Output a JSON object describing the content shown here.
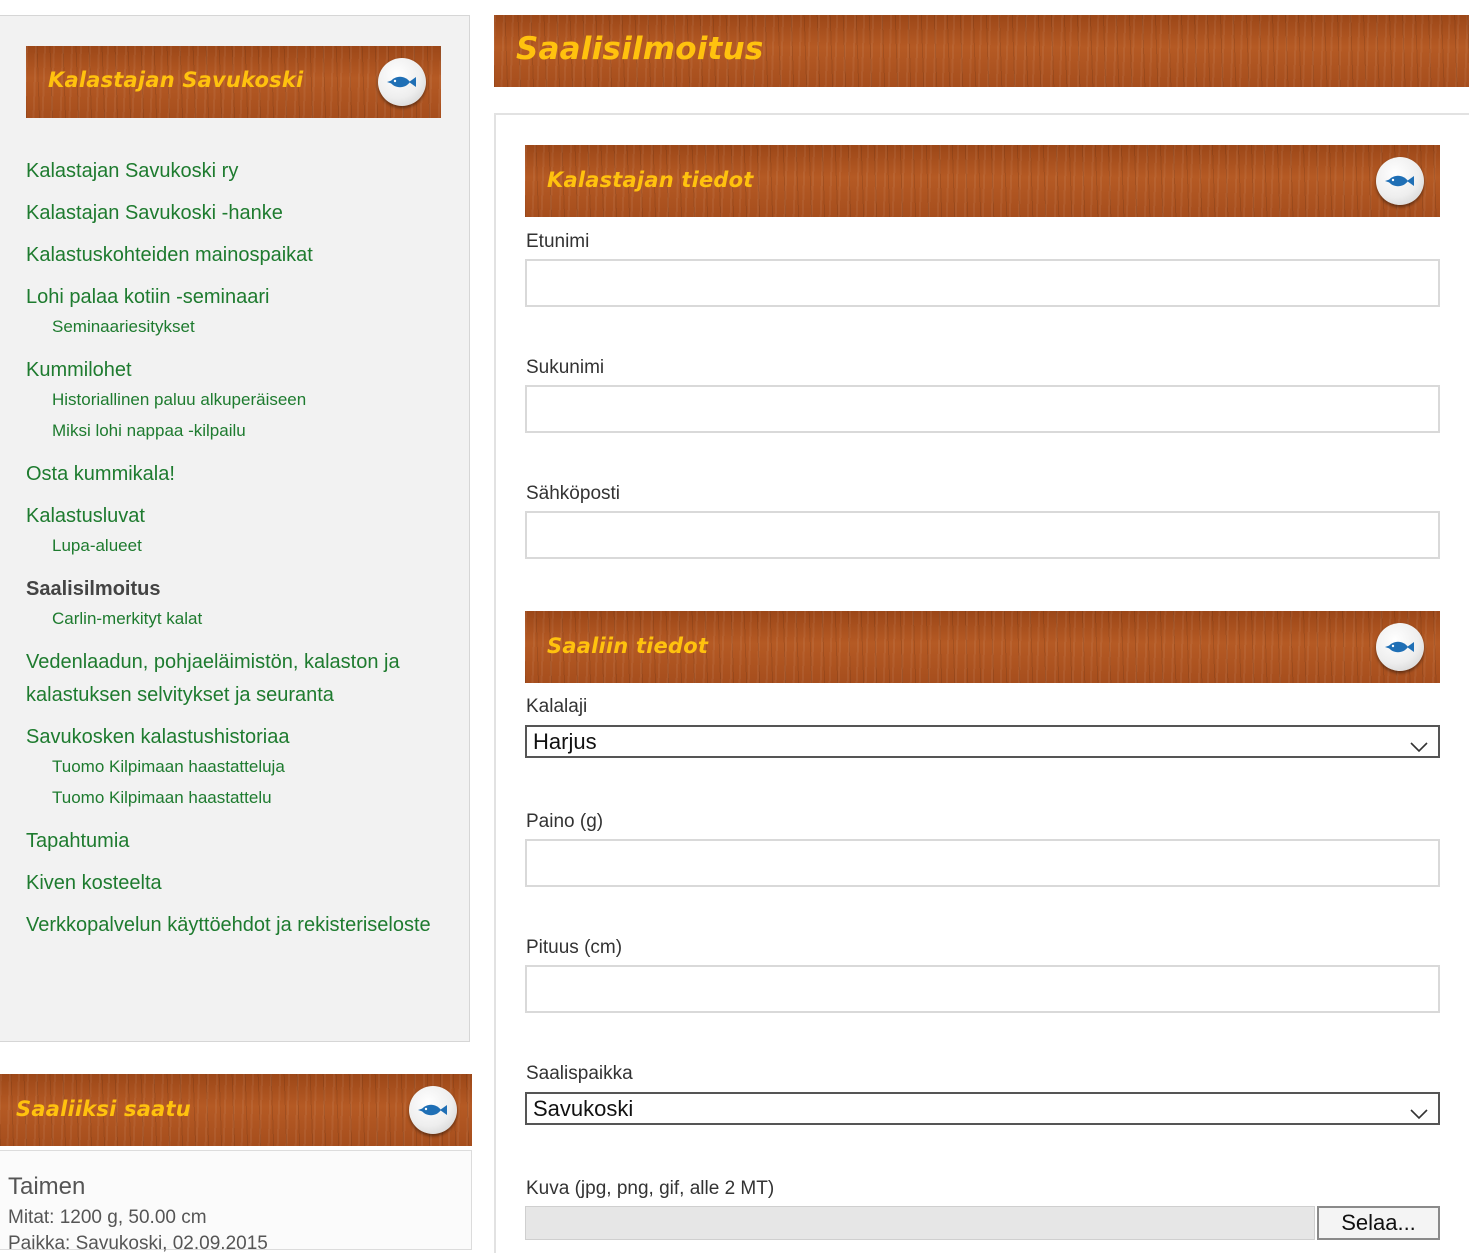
{
  "sidebar": {
    "title": "Kalastajan Savukoski",
    "nav": [
      {
        "label": "Kalastajan Savukoski ry",
        "level": 1
      },
      {
        "label": "Kalastajan Savukoski -hanke",
        "level": 1
      },
      {
        "label": "Kalastuskohteiden mainospaikat",
        "level": 1
      },
      {
        "label": "Lohi palaa kotiin -seminaari",
        "level": 1
      },
      {
        "label": "Seminaariesitykset",
        "level": 2
      },
      {
        "label": "Kummilohet",
        "level": 1
      },
      {
        "label": "Historiallinen paluu alkuperäiseen",
        "level": 2
      },
      {
        "label": "Miksi lohi nappaa -kilpailu",
        "level": 2
      },
      {
        "label": "Osta kummikala!",
        "level": 1
      },
      {
        "label": "Kalastusluvat",
        "level": 1
      },
      {
        "label": "Lupa-alueet",
        "level": 2
      },
      {
        "label": "Saalisilmoitus",
        "level": 1,
        "active": true
      },
      {
        "label": "Carlin-merkityt kalat",
        "level": 2
      },
      {
        "label": "Vedenlaadun, pohjaeläimistön, kalaston ja kalastuksen selvitykset ja seuranta",
        "level": 1
      },
      {
        "label": "Savukosken kalastushistoriaa",
        "level": 1
      },
      {
        "label": "Tuomo Kilpimaan haastatteluja",
        "level": 2
      },
      {
        "label": "Tuomo Kilpimaan haastattelu",
        "level": 2
      },
      {
        "label": "Tapahtumia",
        "level": 1
      },
      {
        "label": "Kiven kosteelta",
        "level": 1
      },
      {
        "label": "Verkkopalvelun käyttöehdot ja rekisteriseloste",
        "level": 1
      }
    ]
  },
  "catch_widget": {
    "title": "Saaliiksi saatu",
    "species": "Taimen",
    "measures": "Mitat: 1200 g, 50.00 cm",
    "place": "Paikka: Savukoski, 02.09.2015"
  },
  "main": {
    "title": "Saalisilmoitus",
    "fisher_section": {
      "title": "Kalastajan tiedot",
      "first_name_label": "Etunimi",
      "last_name_label": "Sukunimi",
      "email_label": "Sähköposti"
    },
    "catch_section": {
      "title": "Saaliin tiedot",
      "species_label": "Kalalaji",
      "species_value": "Harjus",
      "weight_label": "Paino (g)",
      "length_label": "Pituus (cm)",
      "place_label": "Saalispaikka",
      "place_value": "Savukoski",
      "image_label": "Kuva (jpg, png, gif, alle 2 MT)",
      "browse_label": "Selaa..."
    }
  },
  "icons": {
    "badge": "fish-icon"
  },
  "colors": {
    "wood": "#a8501f",
    "heading_yellow": "#ffc20e",
    "link_green": "#1e7b2f"
  }
}
